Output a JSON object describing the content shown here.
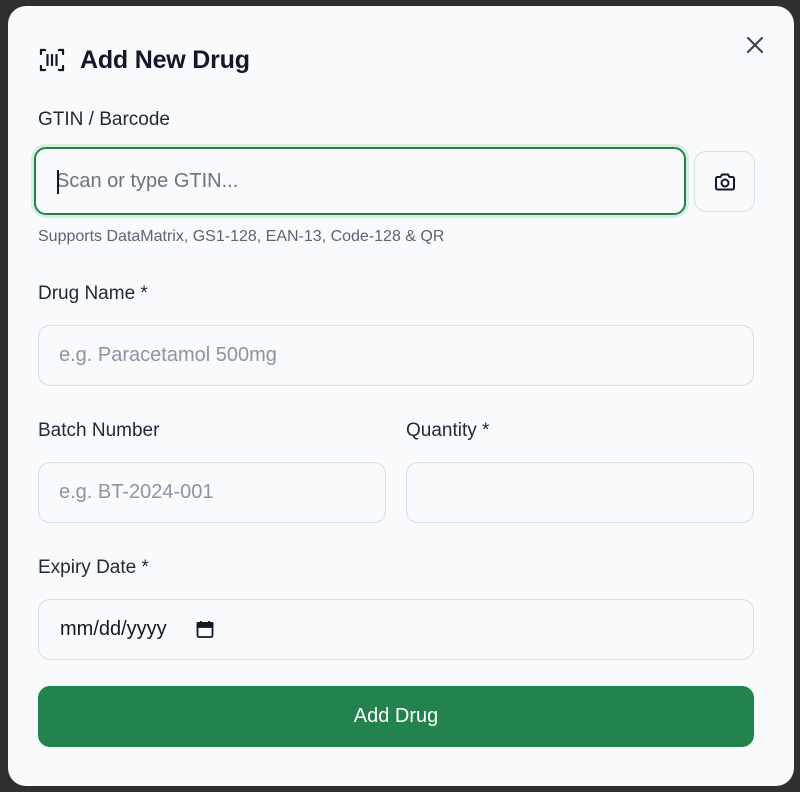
{
  "dialog": {
    "title": "Add New Drug",
    "title_icon": "barcode-scan-icon",
    "close_icon": "close-icon"
  },
  "gtin": {
    "label": "GTIN / Barcode",
    "placeholder": "Scan or type GTIN...",
    "value": "",
    "hint": "Supports DataMatrix, GS1-128, EAN-13, Code-128 & QR",
    "camera_icon": "camera-icon"
  },
  "drug_name": {
    "label": "Drug Name *",
    "placeholder": "e.g. Paracetamol 500mg",
    "value": ""
  },
  "batch_number": {
    "label": "Batch Number",
    "placeholder": "e.g. BT-2024-001",
    "value": ""
  },
  "quantity": {
    "label": "Quantity *",
    "placeholder": "",
    "value": ""
  },
  "expiry_date": {
    "label": "Expiry Date *",
    "display": "mm/dd/yyyy",
    "calendar_icon": "calendar-icon"
  },
  "submit": {
    "label": "Add Drug"
  },
  "colors": {
    "primary": "#22834f",
    "focus_ring": "#23834f",
    "background": "#f8fafc",
    "border": "#d7dde5"
  }
}
